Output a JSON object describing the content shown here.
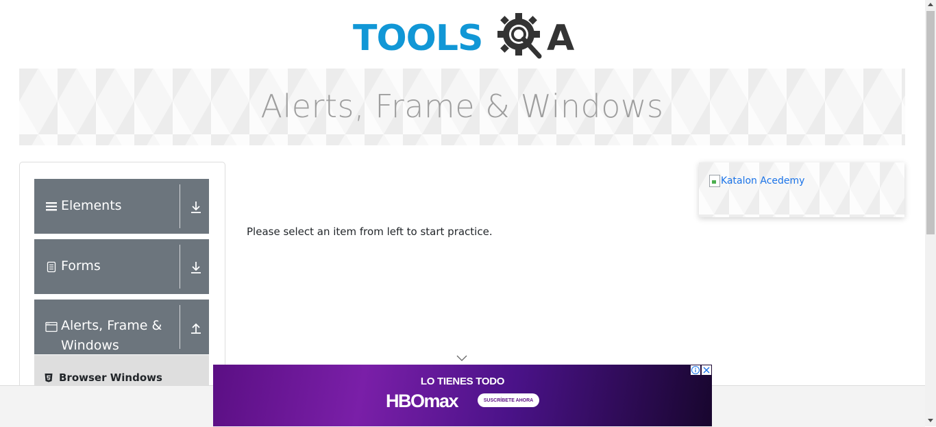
{
  "header": {
    "logo_text": "TOOLS",
    "logo_suffix": "A"
  },
  "banner": {
    "title": "Alerts, Frame & Windows"
  },
  "sidebar": {
    "groups": [
      {
        "label": "Elements",
        "icon": "hamburger-icon",
        "state": "collapsed"
      },
      {
        "label": "Forms",
        "icon": "document-icon",
        "state": "collapsed"
      },
      {
        "label": "Alerts, Frame & Windows",
        "icon": "window-icon",
        "state": "expanded"
      }
    ],
    "items": [
      {
        "label": "Browser Windows",
        "icon": "html5-icon"
      }
    ]
  },
  "main": {
    "message": "Please select an item from left to start practice."
  },
  "right_ad": {
    "alt_text": "Katalon Acedemy"
  },
  "bottom_ad": {
    "headline": "LO TIENES TODO",
    "brand": "HBOmax",
    "cta": "SUSCRÍBETE AHORA",
    "colors": {
      "start": "#5b0f84",
      "end": "#18062e"
    }
  },
  "colors": {
    "accent": "#1197d6",
    "sidebar_group_bg": "#6c757d",
    "submenu_bg": "#dedede",
    "banner_title": "#9e9e9e"
  }
}
